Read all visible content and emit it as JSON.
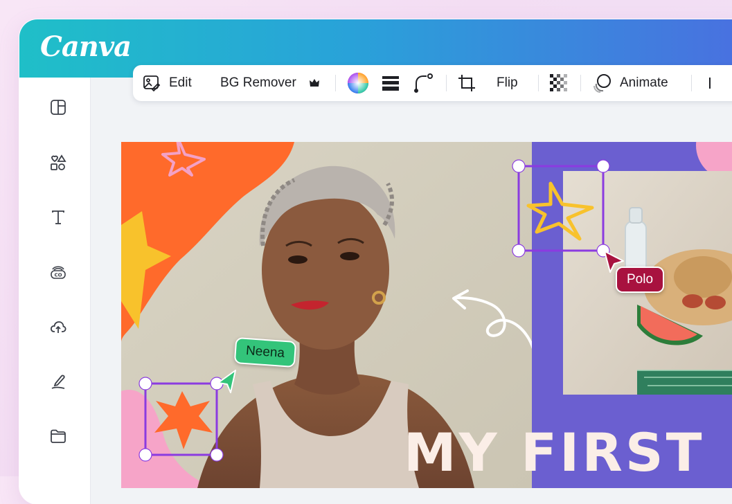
{
  "app": {
    "logo_text": "Canva"
  },
  "sidebar": {
    "items": [
      {
        "name": "templates",
        "icon": "layout-panel-icon"
      },
      {
        "name": "elements",
        "icon": "shapes-icon"
      },
      {
        "name": "text",
        "icon": "text-icon"
      },
      {
        "name": "brand",
        "icon": "crown-co-icon"
      },
      {
        "name": "uploads",
        "icon": "cloud-upload-icon"
      },
      {
        "name": "draw",
        "icon": "pen-draw-icon"
      },
      {
        "name": "projects",
        "icon": "folder-icon"
      }
    ]
  },
  "toolbar": {
    "edit_label": "Edit",
    "bg_remover_label": "BG Remover",
    "flip_label": "Flip",
    "animate_label": "Animate"
  },
  "canvas": {
    "headline": "MY FIRST",
    "collaborators": [
      {
        "name": "Neena",
        "color": "#33c47a"
      },
      {
        "name": "Polo",
        "color": "#a8123f"
      }
    ]
  },
  "colors": {
    "header_start": "#1fbfc8",
    "header_end": "#4a6fe0",
    "selection": "#8b3be0",
    "canvas_purple": "#6b5fd0",
    "blob_orange": "#ff6a2b",
    "star_yellow": "#f8c22c"
  }
}
